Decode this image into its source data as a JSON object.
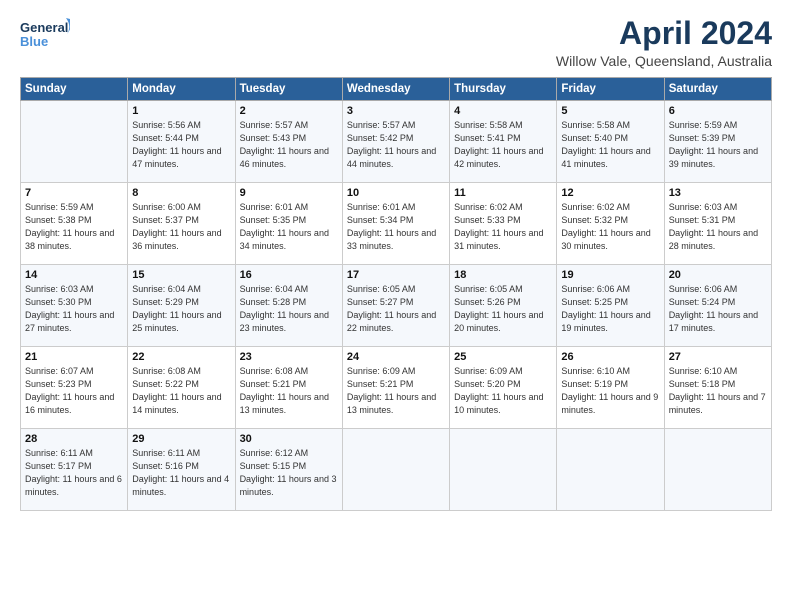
{
  "header": {
    "logo_line1": "General",
    "logo_line2": "Blue",
    "title": "April 2024",
    "subtitle": "Willow Vale, Queensland, Australia"
  },
  "days_of_week": [
    "Sunday",
    "Monday",
    "Tuesday",
    "Wednesday",
    "Thursday",
    "Friday",
    "Saturday"
  ],
  "weeks": [
    [
      {
        "num": "",
        "sunrise": "",
        "sunset": "",
        "daylight": ""
      },
      {
        "num": "1",
        "sunrise": "Sunrise: 5:56 AM",
        "sunset": "Sunset: 5:44 PM",
        "daylight": "Daylight: 11 hours and 47 minutes."
      },
      {
        "num": "2",
        "sunrise": "Sunrise: 5:57 AM",
        "sunset": "Sunset: 5:43 PM",
        "daylight": "Daylight: 11 hours and 46 minutes."
      },
      {
        "num": "3",
        "sunrise": "Sunrise: 5:57 AM",
        "sunset": "Sunset: 5:42 PM",
        "daylight": "Daylight: 11 hours and 44 minutes."
      },
      {
        "num": "4",
        "sunrise": "Sunrise: 5:58 AM",
        "sunset": "Sunset: 5:41 PM",
        "daylight": "Daylight: 11 hours and 42 minutes."
      },
      {
        "num": "5",
        "sunrise": "Sunrise: 5:58 AM",
        "sunset": "Sunset: 5:40 PM",
        "daylight": "Daylight: 11 hours and 41 minutes."
      },
      {
        "num": "6",
        "sunrise": "Sunrise: 5:59 AM",
        "sunset": "Sunset: 5:39 PM",
        "daylight": "Daylight: 11 hours and 39 minutes."
      }
    ],
    [
      {
        "num": "7",
        "sunrise": "Sunrise: 5:59 AM",
        "sunset": "Sunset: 5:38 PM",
        "daylight": "Daylight: 11 hours and 38 minutes."
      },
      {
        "num": "8",
        "sunrise": "Sunrise: 6:00 AM",
        "sunset": "Sunset: 5:37 PM",
        "daylight": "Daylight: 11 hours and 36 minutes."
      },
      {
        "num": "9",
        "sunrise": "Sunrise: 6:01 AM",
        "sunset": "Sunset: 5:35 PM",
        "daylight": "Daylight: 11 hours and 34 minutes."
      },
      {
        "num": "10",
        "sunrise": "Sunrise: 6:01 AM",
        "sunset": "Sunset: 5:34 PM",
        "daylight": "Daylight: 11 hours and 33 minutes."
      },
      {
        "num": "11",
        "sunrise": "Sunrise: 6:02 AM",
        "sunset": "Sunset: 5:33 PM",
        "daylight": "Daylight: 11 hours and 31 minutes."
      },
      {
        "num": "12",
        "sunrise": "Sunrise: 6:02 AM",
        "sunset": "Sunset: 5:32 PM",
        "daylight": "Daylight: 11 hours and 30 minutes."
      },
      {
        "num": "13",
        "sunrise": "Sunrise: 6:03 AM",
        "sunset": "Sunset: 5:31 PM",
        "daylight": "Daylight: 11 hours and 28 minutes."
      }
    ],
    [
      {
        "num": "14",
        "sunrise": "Sunrise: 6:03 AM",
        "sunset": "Sunset: 5:30 PM",
        "daylight": "Daylight: 11 hours and 27 minutes."
      },
      {
        "num": "15",
        "sunrise": "Sunrise: 6:04 AM",
        "sunset": "Sunset: 5:29 PM",
        "daylight": "Daylight: 11 hours and 25 minutes."
      },
      {
        "num": "16",
        "sunrise": "Sunrise: 6:04 AM",
        "sunset": "Sunset: 5:28 PM",
        "daylight": "Daylight: 11 hours and 23 minutes."
      },
      {
        "num": "17",
        "sunrise": "Sunrise: 6:05 AM",
        "sunset": "Sunset: 5:27 PM",
        "daylight": "Daylight: 11 hours and 22 minutes."
      },
      {
        "num": "18",
        "sunrise": "Sunrise: 6:05 AM",
        "sunset": "Sunset: 5:26 PM",
        "daylight": "Daylight: 11 hours and 20 minutes."
      },
      {
        "num": "19",
        "sunrise": "Sunrise: 6:06 AM",
        "sunset": "Sunset: 5:25 PM",
        "daylight": "Daylight: 11 hours and 19 minutes."
      },
      {
        "num": "20",
        "sunrise": "Sunrise: 6:06 AM",
        "sunset": "Sunset: 5:24 PM",
        "daylight": "Daylight: 11 hours and 17 minutes."
      }
    ],
    [
      {
        "num": "21",
        "sunrise": "Sunrise: 6:07 AM",
        "sunset": "Sunset: 5:23 PM",
        "daylight": "Daylight: 11 hours and 16 minutes."
      },
      {
        "num": "22",
        "sunrise": "Sunrise: 6:08 AM",
        "sunset": "Sunset: 5:22 PM",
        "daylight": "Daylight: 11 hours and 14 minutes."
      },
      {
        "num": "23",
        "sunrise": "Sunrise: 6:08 AM",
        "sunset": "Sunset: 5:21 PM",
        "daylight": "Daylight: 11 hours and 13 minutes."
      },
      {
        "num": "24",
        "sunrise": "Sunrise: 6:09 AM",
        "sunset": "Sunset: 5:21 PM",
        "daylight": "Daylight: 11 hours and 13 minutes."
      },
      {
        "num": "25",
        "sunrise": "Sunrise: 6:09 AM",
        "sunset": "Sunset: 5:20 PM",
        "daylight": "Daylight: 11 hours and 10 minutes."
      },
      {
        "num": "26",
        "sunrise": "Sunrise: 6:10 AM",
        "sunset": "Sunset: 5:19 PM",
        "daylight": "Daylight: 11 hours and 9 minutes."
      },
      {
        "num": "27",
        "sunrise": "Sunrise: 6:10 AM",
        "sunset": "Sunset: 5:18 PM",
        "daylight": "Daylight: 11 hours and 7 minutes."
      }
    ],
    [
      {
        "num": "28",
        "sunrise": "Sunrise: 6:11 AM",
        "sunset": "Sunset: 5:17 PM",
        "daylight": "Daylight: 11 hours and 6 minutes."
      },
      {
        "num": "29",
        "sunrise": "Sunrise: 6:11 AM",
        "sunset": "Sunset: 5:16 PM",
        "daylight": "Daylight: 11 hours and 4 minutes."
      },
      {
        "num": "30",
        "sunrise": "Sunrise: 6:12 AM",
        "sunset": "Sunset: 5:15 PM",
        "daylight": "Daylight: 11 hours and 3 minutes."
      },
      {
        "num": "",
        "sunrise": "",
        "sunset": "",
        "daylight": ""
      },
      {
        "num": "",
        "sunrise": "",
        "sunset": "",
        "daylight": ""
      },
      {
        "num": "",
        "sunrise": "",
        "sunset": "",
        "daylight": ""
      },
      {
        "num": "",
        "sunrise": "",
        "sunset": "",
        "daylight": ""
      }
    ]
  ]
}
